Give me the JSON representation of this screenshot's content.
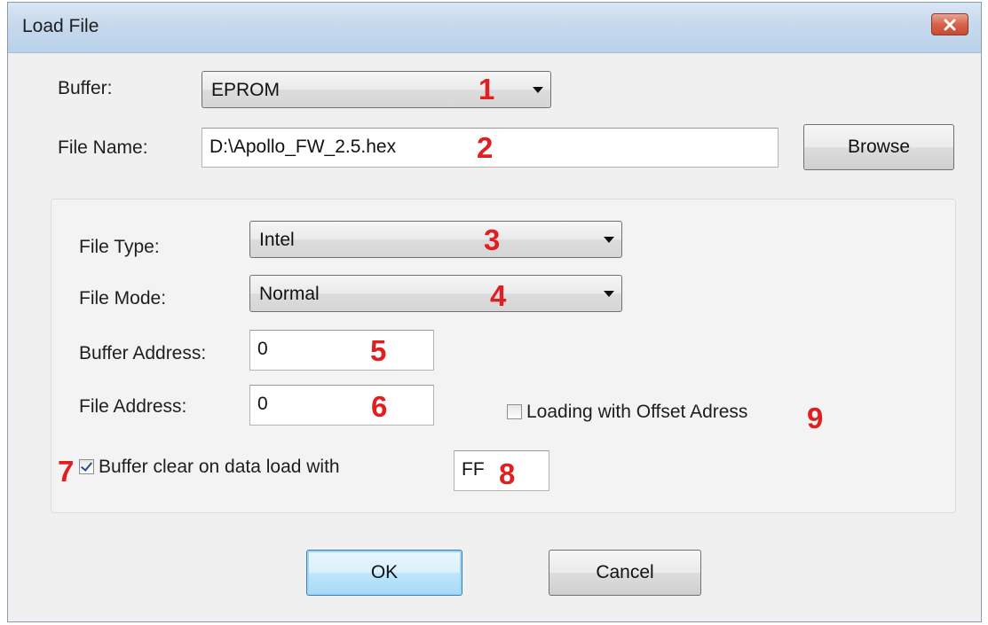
{
  "window": {
    "title": "Load File",
    "close_icon": "close-icon"
  },
  "fields": {
    "buffer": {
      "label": "Buffer:",
      "value": "EPROM",
      "marker": "1"
    },
    "file_name": {
      "label": "File Name:",
      "value": "D:\\Apollo_FW_2.5.hex",
      "marker": "2"
    },
    "file_type": {
      "label": "File Type:",
      "value": "Intel",
      "marker": "3"
    },
    "file_mode": {
      "label": "File Mode:",
      "value": "Normal",
      "marker": "4"
    },
    "buffer_address": {
      "label": "Buffer Address:",
      "value": "0",
      "marker": "5"
    },
    "file_address": {
      "label": "File Address:",
      "value": "0",
      "marker": "6"
    },
    "clear_buffer": {
      "marker": "7",
      "label": "Buffer clear on data load with",
      "checked": true
    },
    "clear_value": {
      "value": "FF",
      "marker": "8"
    },
    "offset_loading": {
      "label": "Loading with Offset Adress",
      "marker": "9",
      "checked": false
    }
  },
  "buttons": {
    "browse": "Browse",
    "ok": "OK",
    "cancel": "Cancel"
  },
  "colors": {
    "marker": "#e02020",
    "default_button_border": "#3c7fb1"
  }
}
